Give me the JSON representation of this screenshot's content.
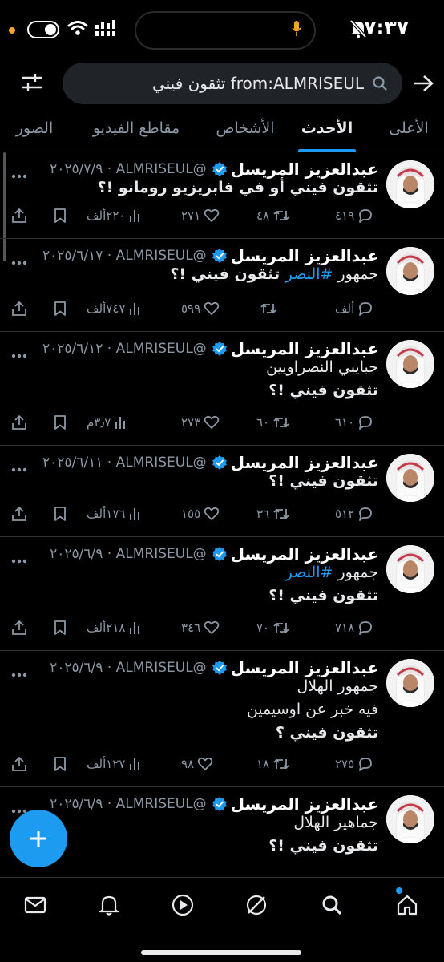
{
  "status": {
    "time": "٧:٣٧"
  },
  "search": {
    "query": "from:ALMRISEUL تثقون فيني"
  },
  "tabs": [
    {
      "label": "الأعلى",
      "active": false
    },
    {
      "label": "الأحدث",
      "active": true
    },
    {
      "label": "الأشخاص",
      "active": false
    },
    {
      "label": "مقاطع الفيديو",
      "active": false
    },
    {
      "label": "الصور",
      "active": false
    }
  ],
  "tweets": [
    {
      "name": "عبدالعزيز المريسل",
      "handle_date": "@ALMRISEUL · ٢٠٢٥/٧/٩",
      "lines": [
        [
          "تثقون فيني أو في فابريزيو رومانو !؟"
        ]
      ],
      "replies": "٤١٩",
      "reposts": "٤٨",
      "likes": "٢٧١",
      "views": "٢٢٠ألف"
    },
    {
      "name": "عبدالعزيز المريسل",
      "handle_date": "@ALMRISEUL · ٢٠٢٥/٦/١٧",
      "lines": [
        [
          "جمهور ",
          "#النصر",
          " تثقون فيني !؟"
        ]
      ],
      "replies": "ألف",
      "reposts": "",
      "likes": "٥٩٩",
      "views": "٧٤٧ألف"
    },
    {
      "name": "عبدالعزيز المريسل",
      "handle_date": "@ALMRISEUL · ٢٠٢٥/٦/١٢",
      "lines": [
        [
          "حبايبي النصراويين"
        ],
        [
          "تثقون فيني !؟"
        ]
      ],
      "replies": "٦١٠",
      "reposts": "٦٠",
      "likes": "٢٧٣",
      "views": "٣٫٧م"
    },
    {
      "name": "عبدالعزيز المريسل",
      "handle_date": "@ALMRISEUL · ٢٠٢٥/٦/١١",
      "lines": [
        [
          "تثقون فيني !؟"
        ]
      ],
      "replies": "٥١٢",
      "reposts": "٣٦",
      "likes": "١٥٥",
      "views": "١٧٦ألف"
    },
    {
      "name": "عبدالعزيز المريسل",
      "handle_date": "@ALMRISEUL · ٢٠٢٥/٦/٩",
      "lines": [
        [
          "جمهور ",
          "#النصر"
        ],
        [
          "تثقون فيني !؟"
        ]
      ],
      "replies": "٧١٨",
      "reposts": "٧٠",
      "likes": "٣٤٦",
      "views": "٢١٨ألف"
    },
    {
      "name": "عبدالعزيز المريسل",
      "handle_date": "@ALMRISEUL · ٢٠٢٥/٦/٩",
      "lines": [
        [
          "جمهور الهلال"
        ],
        [
          "فيه خبر عن اوسيمين"
        ],
        [
          "تثقون فيني ؟"
        ]
      ],
      "replies": "٢٧٥",
      "reposts": "١٨",
      "likes": "٩٨",
      "views": "١٢٧ألف"
    },
    {
      "name": "عبدالعزيز المريسل",
      "handle_date": "@ALMRISEUL · ٢٠٢٥/٦/٩",
      "lines": [
        [
          "جماهير الهلال"
        ],
        [
          "تثقون فيني !؟"
        ]
      ],
      "replies": "",
      "reposts": "",
      "likes": "",
      "views": ""
    }
  ],
  "colors": {
    "accent": "#1d9bf0",
    "background": "#000000",
    "secondary_text": "#8b98a5"
  }
}
